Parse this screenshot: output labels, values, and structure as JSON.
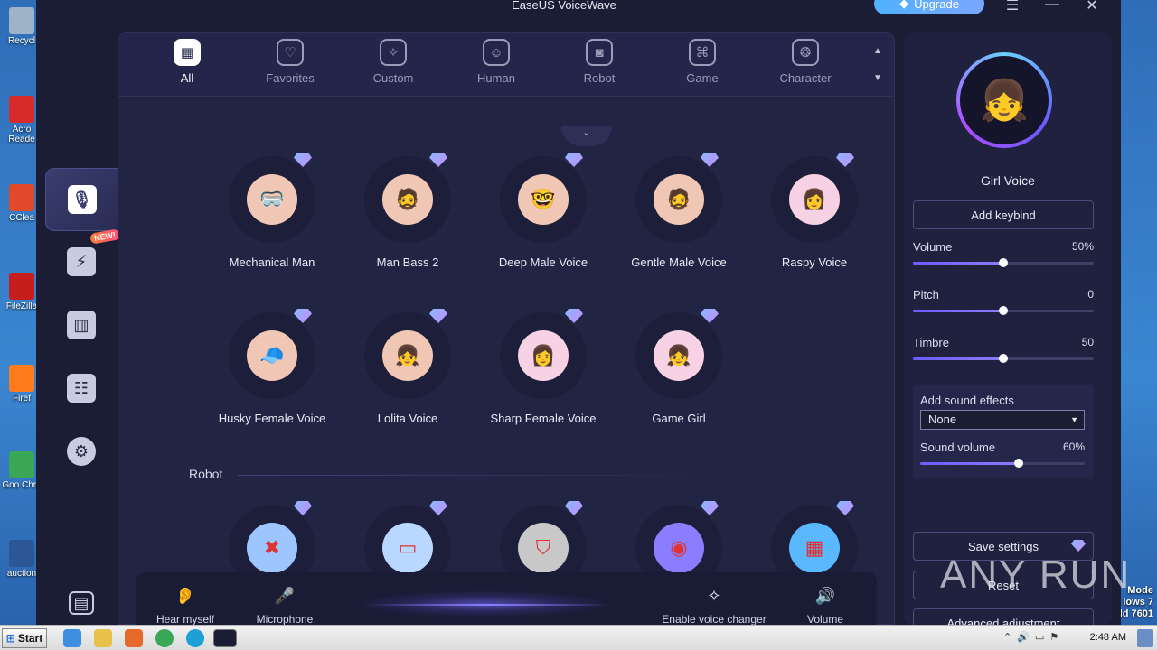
{
  "window": {
    "title": "EaseUS VoiceWave",
    "upgrade_label": "Upgrade"
  },
  "desktop_icons": [
    {
      "label": "Recycl",
      "color": "#9fb3c8"
    },
    {
      "label": "Acro Reade",
      "color": "#d72b2b"
    },
    {
      "label": "CClea",
      "color": "#e04a2a"
    },
    {
      "label": "FileZilla",
      "color": "#c61d1d"
    },
    {
      "label": "Firef",
      "color": "#ff7b1c"
    },
    {
      "label": "Goo Chro",
      "color": "#3aa757"
    },
    {
      "label": "auction",
      "color": "#2b5797"
    }
  ],
  "desktop_corner_text": [
    "Mode",
    "lows 7",
    "ld 7601"
  ],
  "tabs": [
    {
      "label": "All",
      "icon": "grid-icon",
      "active": true
    },
    {
      "label": "Favorites",
      "icon": "heart-icon",
      "active": false
    },
    {
      "label": "Custom",
      "icon": "magic-wand-icon",
      "active": false
    },
    {
      "label": "Human",
      "icon": "human-icon",
      "active": false
    },
    {
      "label": "Robot",
      "icon": "robot-icon",
      "active": false
    },
    {
      "label": "Game",
      "icon": "gamepad-icon",
      "active": false
    },
    {
      "label": "Character",
      "icon": "film-reel-icon",
      "active": false
    }
  ],
  "voices_row1": [
    {
      "name": "Mechanical Man",
      "face": "🥽",
      "bg": "#f0c7b5"
    },
    {
      "name": "Man Bass 2",
      "face": "🧔",
      "bg": "#f0c7b5"
    },
    {
      "name": "Deep Male Voice",
      "face": "🤓",
      "bg": "#f0c7b5"
    },
    {
      "name": "Gentle Male Voice",
      "face": "🧔",
      "bg": "#f0c7b5"
    },
    {
      "name": "Raspy Voice",
      "face": "👩",
      "bg": "#f6d2e4"
    }
  ],
  "voices_row2": [
    {
      "name": "Husky Female Voice",
      "face": "🧢",
      "bg": "#f0c7b5"
    },
    {
      "name": "Lolita Voice",
      "face": "👧",
      "bg": "#f0c7b5"
    },
    {
      "name": "Sharp Female Voice",
      "face": "👩",
      "bg": "#f6d2e4"
    },
    {
      "name": "Game Girl",
      "face": "👧",
      "bg": "#f6d2e4"
    }
  ],
  "section_robot": "Robot",
  "robot_icons": [
    "dead-robot-icon",
    "visor-robot-icon",
    "mecha-robot-icon",
    "antenna-robot-icon",
    "hologram-robot-icon"
  ],
  "bottom_controls": [
    {
      "label": "Hear myself",
      "icon": "ear-icon"
    },
    {
      "label": "Microphone",
      "icon": "microphone-icon"
    },
    {
      "label": "Enable voice changer",
      "icon": "magic-wand-icon"
    },
    {
      "label": "Volume",
      "icon": "speaker-icon"
    }
  ],
  "right_panel": {
    "voice_name": "Girl Voice",
    "keybind_label": "Add keybind",
    "sliders": [
      {
        "label": "Volume",
        "value_text": "50%",
        "fraction": 0.5
      },
      {
        "label": "Pitch",
        "value_text": "0",
        "fraction": 0.5
      },
      {
        "label": "Timbre",
        "value_text": "50",
        "fraction": 0.5
      }
    ],
    "sound_effects": {
      "title": "Add sound effects",
      "selected": "None",
      "volume_label": "Sound volume",
      "volume_text": "60%",
      "volume_fraction": 0.6
    },
    "save_label": "Save settings",
    "reset_label": "Reset",
    "advanced_label": "Advanced adjustment"
  },
  "watermark": "ANY RUN",
  "taskbar": {
    "start_label": "Start",
    "clock": "2:48 AM"
  }
}
